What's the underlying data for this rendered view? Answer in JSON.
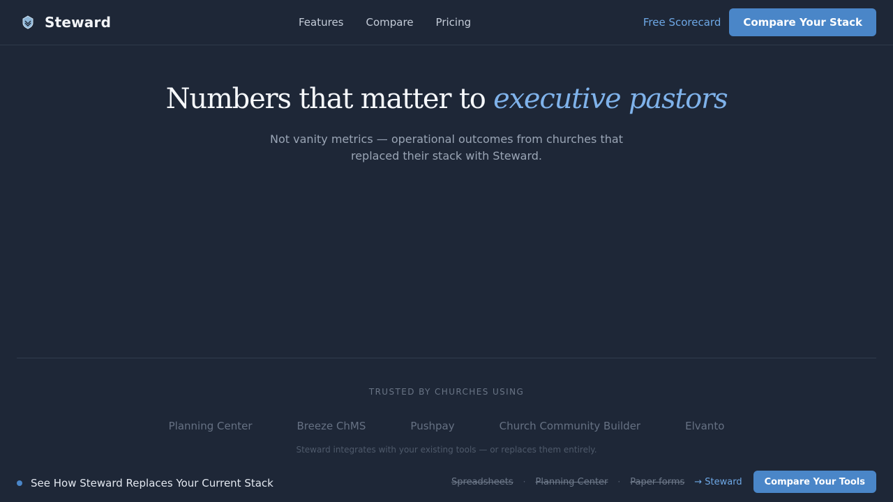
{
  "header": {
    "brand": {
      "name": "Steward",
      "icon": "steward-logo-icon"
    },
    "nav": [
      {
        "label": "Features"
      },
      {
        "label": "Compare"
      },
      {
        "label": "Pricing"
      }
    ],
    "scorecard_link": "Free Scorecard",
    "cta": "Compare Your Stack"
  },
  "hero": {
    "title_main": "Numbers that matter to ",
    "title_accent": "executive pastors",
    "subtitle": "Not vanity metrics — operational outcomes from churches that replaced their stack with Steward."
  },
  "trusted": {
    "label": "TRUSTED BY CHURCHES USING",
    "logos": [
      "Planning Center",
      "Breeze ChMS",
      "Pushpay",
      "Church Community Builder",
      "Elvanto"
    ],
    "note": "Steward integrates with your existing tools — or replaces them entirely."
  },
  "bottom_bar": {
    "title": "See How Steward Replaces Your Current Stack",
    "replaced": [
      "Spreadsheets",
      "Planning Center",
      "Paper forms"
    ],
    "separator": "·",
    "target": "→ Steward",
    "cta": "Compare Your Tools"
  },
  "colors": {
    "background": "#1e2737",
    "accent": "#4a86c8",
    "accent_text": "#7fb2ea"
  }
}
